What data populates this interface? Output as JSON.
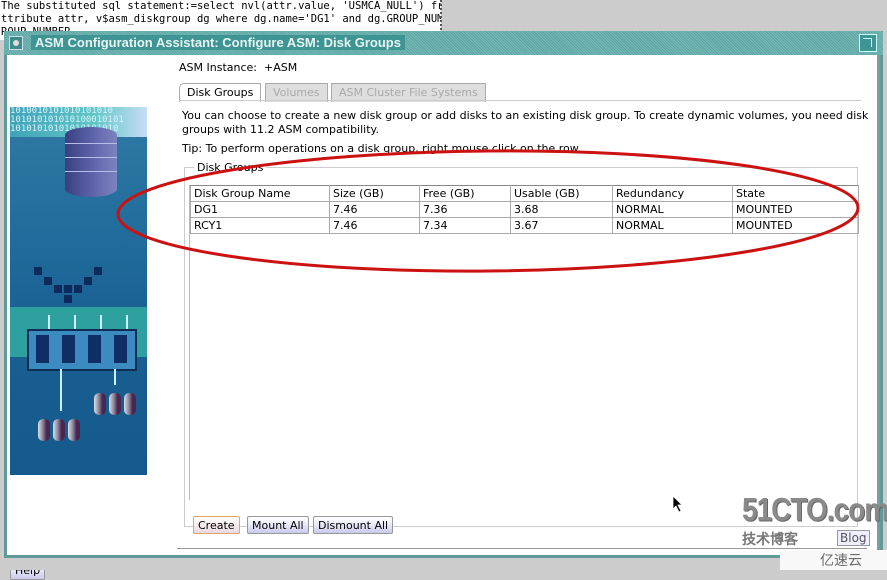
{
  "terminal": {
    "lines": [
      "The substituted sql statement:=select nvl(attr.value, 'USMCA_NULL') from",
      "ttribute attr, v$asm_diskgroup dg where dg.name='DG1' and dg.GROUP_NUMBER",
      "ROUP_NUMBER"
    ]
  },
  "window": {
    "title": "ASM Configuration Assistant: Configure ASM: Disk Groups",
    "sys_menu_icon": "window-menu-icon",
    "maximize_icon": "maximize-icon"
  },
  "instance": {
    "label": "ASM Instance:",
    "value": "+ASM"
  },
  "tabs": [
    {
      "label": "Disk Groups",
      "active": true,
      "enabled": true
    },
    {
      "label": "Volumes",
      "active": false,
      "enabled": false
    },
    {
      "label": "ASM Cluster File Systems",
      "active": false,
      "enabled": false
    }
  ],
  "description": "You can choose to create a new disk group or add disks to an existing disk group. To create dynamic volumes, you need disk groups with 11.2 ASM compatibility.",
  "description_line1": "You can choose to create a new disk group or add disks to an existing disk group. To create dynamic volumes, you need disk",
  "description_line2": "groups with 11.2 ASM compatibility.",
  "tip": "Tip: To perform operations on a disk group, right mouse click on the row.",
  "disk_groups": {
    "group_title": "Disk Groups",
    "columns": [
      "Disk Group Name",
      "Size (GB)",
      "Free (GB)",
      "Usable (GB)",
      "Redundancy",
      "State"
    ],
    "rows": [
      [
        "DG1",
        "7.46",
        "7.36",
        "3.68",
        "NORMAL",
        "MOUNTED"
      ],
      [
        "RCY1",
        "7.46",
        "7.34",
        "3.67",
        "NORMAL",
        "MOUNTED"
      ]
    ]
  },
  "buttons": {
    "create": "Create",
    "mount_all": "Mount All",
    "dismount_all": "Dismount All",
    "help": "Help"
  },
  "annotation": {
    "color": "#cc1111"
  },
  "watermark": {
    "site": "51CTO.com",
    "subtitle": "技术博客",
    "blog": "Blog",
    "brand": "亿速云"
  }
}
